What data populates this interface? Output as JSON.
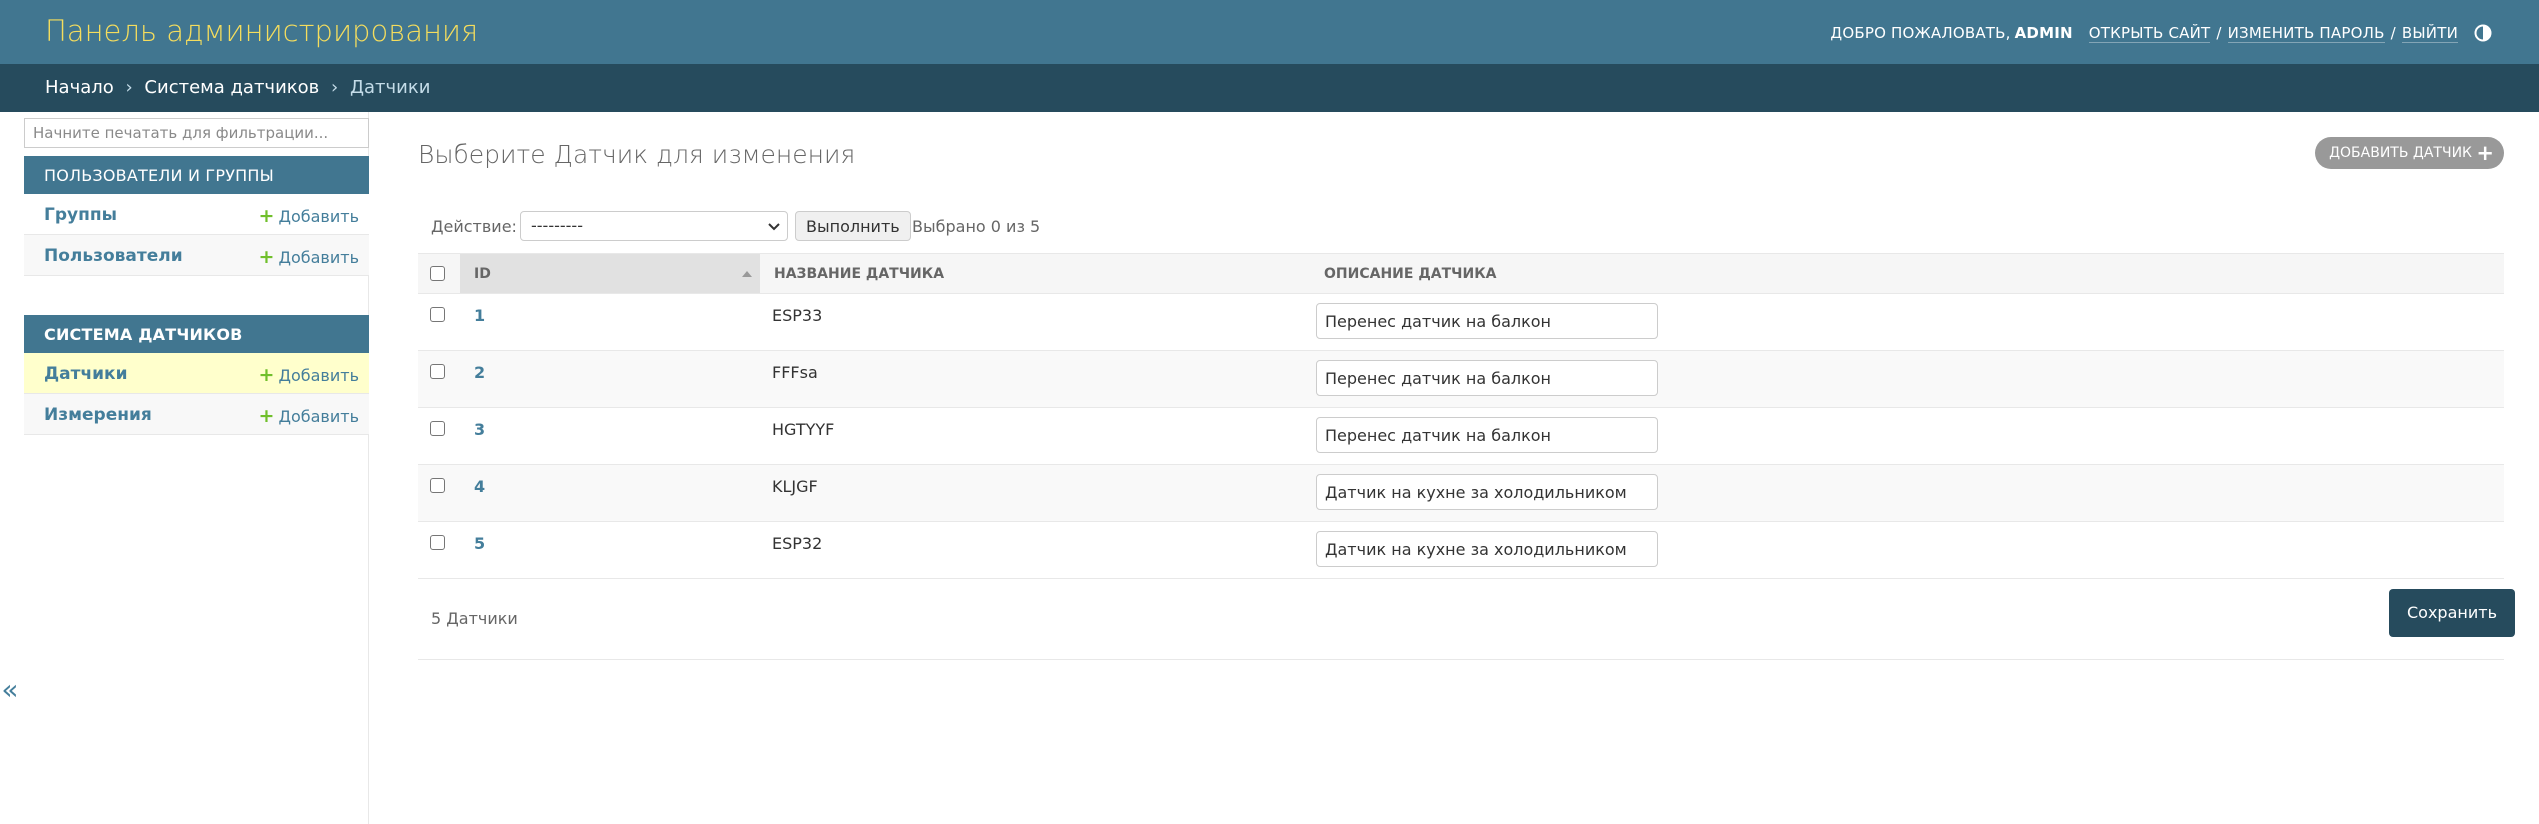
{
  "header": {
    "branding": "Панель администрирования",
    "welcome": "Добро пожаловать,",
    "username": "admin",
    "view_site": "Открыть сайт",
    "separator": "/",
    "change_password": "Изменить пароль",
    "logout": "Выйти",
    "theme_icon": "half-circle-contrast-icon"
  },
  "breadcrumbs": {
    "home": "Начало",
    "app": "Система датчиков",
    "current": "Датчики",
    "separator": "›"
  },
  "sidebar": {
    "filter_placeholder": "Начните печатать для фильтрации...",
    "modules": [
      {
        "caption": "Пользователи и группы",
        "items": [
          {
            "label": "Группы",
            "add": "Добавить"
          },
          {
            "label": "Пользователи",
            "add": "Добавить"
          }
        ]
      },
      {
        "caption": "Система датчиков",
        "items": [
          {
            "label": "Датчики",
            "add": "Добавить",
            "current": true
          },
          {
            "label": "Измерения",
            "add": "Добавить"
          }
        ]
      }
    ],
    "collapse_symbol": "«",
    "plus_symbol": "+"
  },
  "content": {
    "title": "Выберите Датчик для изменения",
    "add_button": "Добавить датчик",
    "add_plus": "+"
  },
  "actions": {
    "label": "Действие:",
    "selected_value": "---------",
    "run_button": "Выполнить",
    "counter": "Выбрано 0 из 5"
  },
  "table": {
    "columns": [
      "ID",
      "Название датчика",
      "Описание датчика"
    ],
    "sorted_column": "ID",
    "rows": [
      {
        "id": "1",
        "name": "ESP33",
        "description": "Перенес датчик на балкон"
      },
      {
        "id": "2",
        "name": "FFFsa",
        "description": "Перенес датчик на балкон"
      },
      {
        "id": "3",
        "name": "HGTYYF",
        "description": "Перенес датчик на балкон"
      },
      {
        "id": "4",
        "name": "KLJGF",
        "description": "Датчик на кухне за холодильником"
      },
      {
        "id": "5",
        "name": "ESP32",
        "description": "Датчик на кухне за холодильником"
      }
    ]
  },
  "paginator": {
    "count": "5 Датчики",
    "save_button": "Сохранить"
  },
  "colors": {
    "header_bg": "#417690",
    "breadcrumbs_bg": "#264b5d",
    "branding": "#f5dd5d",
    "link": "#447e9b",
    "add_green": "#70bf2b",
    "current_row": "#ffffcc"
  }
}
